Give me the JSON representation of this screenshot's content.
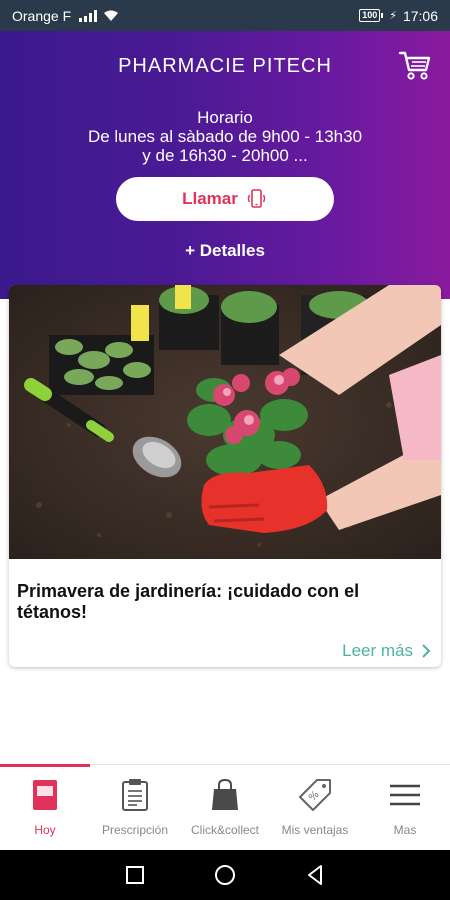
{
  "status_bar": {
    "carrier": "Orange F",
    "battery_level": "100",
    "time": "17:06"
  },
  "header": {
    "pharmacy_name": "PHARMACIE PITECH",
    "hours_title": "Horario",
    "hours_line1": "De lunes al sàbado de 9h00 - 13h30",
    "hours_line2": "y de 16h30 - 20h00 ...",
    "call_label": "Llamar",
    "details_label": "+ Detalles"
  },
  "article": {
    "title": "Primavera de jardinería: ¡cuidado con el tétanos!",
    "read_more": "Leer más"
  },
  "bottom_nav": {
    "items": [
      {
        "label": "Hoy",
        "icon": "today-icon",
        "active": true
      },
      {
        "label": "Prescripción",
        "icon": "prescription-icon",
        "active": false
      },
      {
        "label": "Click&collect",
        "icon": "shopping-bag-icon",
        "active": false
      },
      {
        "label": "Mis ventajas",
        "icon": "discount-tag-icon",
        "active": false
      },
      {
        "label": "Mas",
        "icon": "menu-icon",
        "active": false
      }
    ]
  },
  "colors": {
    "header_gradient_start": "#3a1a8c",
    "header_gradient_end": "#8a1b9f",
    "accent": "#e0325a",
    "read_more": "#4fb3a3"
  }
}
